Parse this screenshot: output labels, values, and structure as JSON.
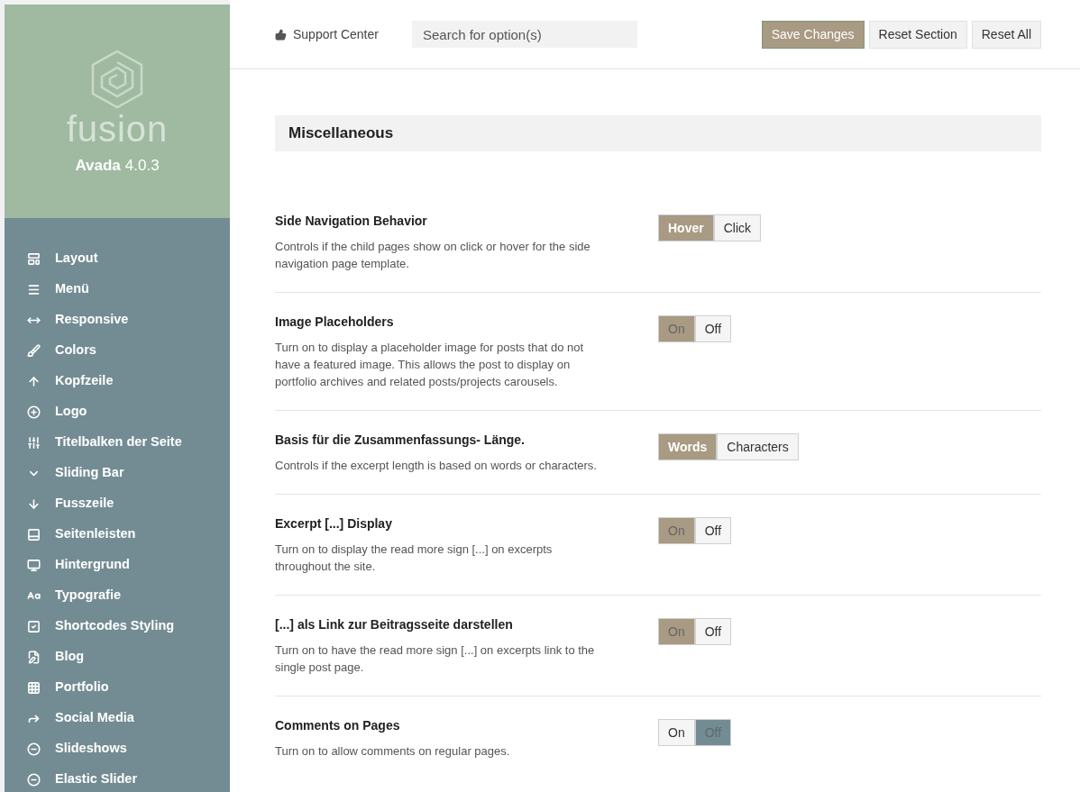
{
  "brand": {
    "logo_text": "fusion",
    "name": "Avada",
    "version": "4.0.3"
  },
  "sidebar": {
    "items": [
      {
        "label": "Layout"
      },
      {
        "label": "Menü"
      },
      {
        "label": "Responsive"
      },
      {
        "label": "Colors"
      },
      {
        "label": "Kopfzeile"
      },
      {
        "label": "Logo"
      },
      {
        "label": "Titelbalken der Seite"
      },
      {
        "label": "Sliding Bar"
      },
      {
        "label": "Fusszeile"
      },
      {
        "label": "Seitenleisten"
      },
      {
        "label": "Hintergrund"
      },
      {
        "label": "Typografie"
      },
      {
        "label": "Shortcodes Styling"
      },
      {
        "label": "Blog"
      },
      {
        "label": "Portfolio"
      },
      {
        "label": "Social Media"
      },
      {
        "label": "Slideshows"
      },
      {
        "label": "Elastic Slider"
      }
    ]
  },
  "topbar": {
    "support": "Support Center",
    "search": {
      "placeholder": "Search for option(s)"
    },
    "buttons": [
      {
        "label": "Save Changes",
        "kind": "primary"
      },
      {
        "label": "Reset Section",
        "kind": "secondary"
      },
      {
        "label": "Reset All",
        "kind": "secondary"
      }
    ]
  },
  "section": {
    "title": "Miscellaneous"
  },
  "settings": [
    {
      "title": "Side Navigation Behavior",
      "description": "Controls if the child pages show on click or hover for the side navigation page template.",
      "kind": "buttonset",
      "options": [
        {
          "label": "Hover",
          "selected": true
        },
        {
          "label": "Click",
          "selected": false
        }
      ]
    },
    {
      "title": "Image Placeholders",
      "description": "Turn on to display a placeholder image for posts that do not have a featured image. This allows the post to display on portfolio archives and related posts/projects carousels.",
      "kind": "switch",
      "options": [
        {
          "label": "On",
          "selected": true
        },
        {
          "label": "Off",
          "selected": false
        }
      ]
    },
    {
      "title": "Basis für die Zusammenfassungs- Länge.",
      "description": "Controls if the excerpt length is based on words or characters.",
      "kind": "buttonset",
      "options": [
        {
          "label": "Words",
          "selected": true
        },
        {
          "label": "Characters",
          "selected": false
        }
      ]
    },
    {
      "title": "Excerpt [...] Display",
      "description": "Turn on to display the read more sign [...] on excerpts throughout the site.",
      "kind": "switch",
      "options": [
        {
          "label": "On",
          "selected": true
        },
        {
          "label": "Off",
          "selected": false
        }
      ]
    },
    {
      "title": "[...] als Link zur Beitragsseite darstellen",
      "description": "Turn on to have the read more sign [...] on excerpts link to the single post page.",
      "kind": "switch",
      "options": [
        {
          "label": "On",
          "selected": true
        },
        {
          "label": "Off",
          "selected": false
        }
      ]
    },
    {
      "title": "Comments on Pages",
      "description": "Turn on to allow comments on regular pages.",
      "kind": "switch",
      "options": [
        {
          "label": "On",
          "selected": false
        },
        {
          "label": "Off",
          "selected": true
        }
      ]
    }
  ]
}
